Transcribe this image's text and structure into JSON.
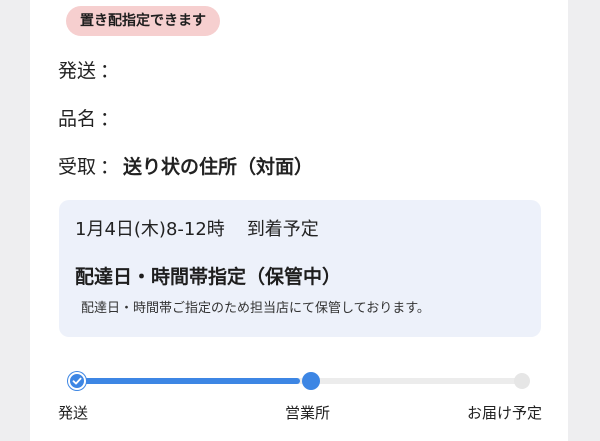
{
  "badge": {
    "label": "置き配指定できます"
  },
  "shipment": {
    "sender": {
      "label": "発送",
      "separator": "：",
      "value": ""
    },
    "item": {
      "label": "品名",
      "separator": "：",
      "value": ""
    },
    "receiver": {
      "label": "受取",
      "separator": "：",
      "value": "送り状の住所（対面）"
    }
  },
  "delivery": {
    "arrival_datetime": "1月4日(木)8-12時",
    "arrival_suffix": "到着予定",
    "status_title": "配達日・時間帯指定（保管中）",
    "status_note": "配達日・時間帯ご指定のため担当店にて保管しております。"
  },
  "progress": {
    "current_step": 2,
    "total_steps": 3,
    "steps": [
      {
        "label": "発送",
        "state": "done"
      },
      {
        "label": "営業所",
        "state": "current"
      },
      {
        "label": "お届け予定",
        "state": "pending"
      }
    ]
  },
  "colors": {
    "accent": "#3d86e4",
    "badge_background": "#f6cfcf",
    "box_background": "#edf1fa",
    "track": "#ececec"
  },
  "icons": {
    "completed_step": "check-icon"
  }
}
